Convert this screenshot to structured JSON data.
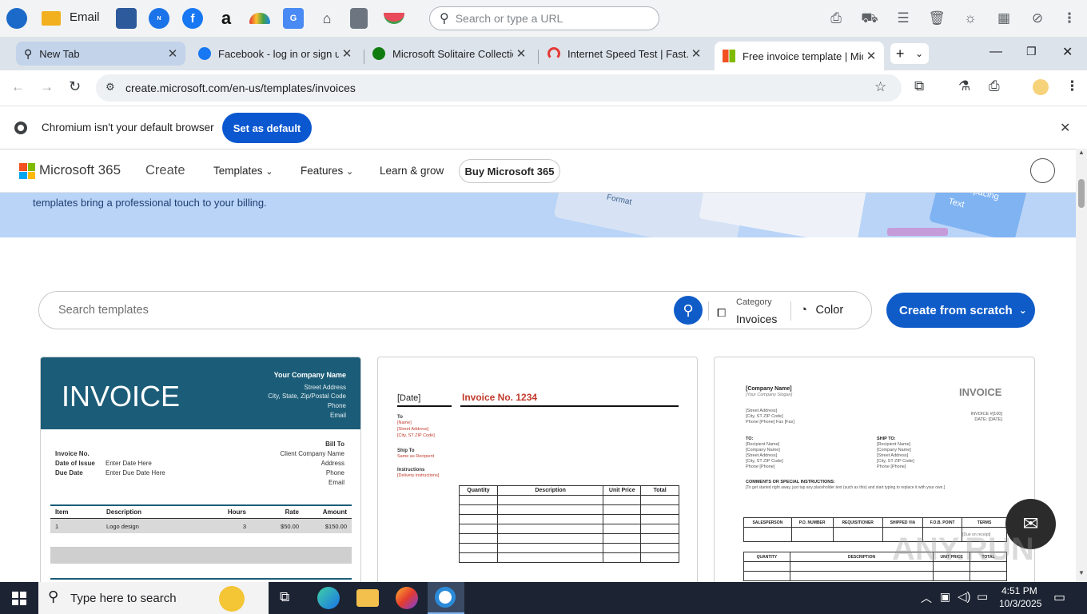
{
  "launcher": {
    "email_label": "Email",
    "omnibox_placeholder": "Search or type a URL"
  },
  "tabs": [
    {
      "title": "New Tab"
    },
    {
      "title": "Facebook - log in or sign up"
    },
    {
      "title": "Microsoft Solitaire Collection"
    },
    {
      "title": "Internet Speed Test | Fast.com"
    },
    {
      "title": "Free invoice template | Microsoft Create"
    }
  ],
  "address_bar": {
    "url": "create.microsoft.com/en-us/templates/invoices"
  },
  "infobar": {
    "message": "Chromium isn't your default browser",
    "button": "Set as default"
  },
  "site_nav": {
    "brand": "Microsoft 365",
    "create": "Create",
    "items": [
      "Templates",
      "Features",
      "Learn & grow"
    ],
    "buy": "Buy Microsoft 365"
  },
  "banner": {
    "text": "templates bring a professional touch to your billing.",
    "illustration_words": [
      "Format",
      "Spacing",
      "Text"
    ]
  },
  "search": {
    "placeholder": "Search templates",
    "category_label": "Category",
    "category_value": "Invoices",
    "color_label": "Color",
    "create_button": "Create from scratch"
  },
  "templates": {
    "card1": {
      "title": "INVOICE",
      "company": "Your Company Name",
      "address_lines": [
        "Street Address",
        "City, State, Zip/Postal Code",
        "Phone",
        "Email"
      ],
      "labels": [
        "Invoice No.",
        "Date of Issue",
        "Due Date"
      ],
      "values": [
        "",
        "Enter Date Here",
        "Enter Due Date Here"
      ],
      "bill_to_label": "Bill To",
      "bill_to_lines": [
        "Client Company Name",
        "Address",
        "Phone",
        "Email"
      ],
      "columns": [
        "Item",
        "Description",
        "Hours",
        "Rate",
        "Amount"
      ],
      "row": [
        "1",
        "Logo design",
        "3",
        "$50.00",
        "$150.00"
      ]
    },
    "card2": {
      "date": "[Date]",
      "title": "Invoice No. 1234",
      "to_label": "To",
      "to_lines": [
        "[Name]",
        "[Street Address]",
        "[City, ST ZIP Code]"
      ],
      "ship_label": "Ship To",
      "ship_line": "Same as Recipient",
      "instr_label": "Instructions",
      "instr_line": "[Delivery instructions]",
      "columns": [
        "Quantity",
        "Description",
        "Unit Price",
        "Total"
      ]
    },
    "card3": {
      "company": "[Company Name]",
      "slogan": "[Your Company Slogan]",
      "title": "INVOICE",
      "address_lines": [
        "[Street Address]",
        "[City, ST ZIP Code]",
        "Phone [Phone]   Fax [Fax]"
      ],
      "invoice_lines": [
        "INVOICE #[100]",
        "DATE: [DATE]"
      ],
      "to_label": "TO:",
      "to_lines": [
        "[Recipient Name]",
        "[Company Name]",
        "[Street Address]",
        "[City, ST ZIP Code]",
        "Phone [Phone]"
      ],
      "ship_label": "SHIP TO:",
      "ship_lines": [
        "[Recipient Name]",
        "[Company Name]",
        "[Street Address]",
        "[City, ST ZIP Code]",
        "Phone [Phone]"
      ],
      "comments_label": "COMMENTS OR SPECIAL INSTRUCTIONS:",
      "comments_text": "[To get started right away, just tap any placeholder text (such as this) and start typing to replace it with your own.]",
      "table1": [
        "SALESPERSON",
        "P.O. NUMBER",
        "REQUISITIONER",
        "SHIPPED VIA",
        "F.O.B. POINT",
        "TERMS"
      ],
      "terms_value": "[Due on receipt]",
      "table2": [
        "QUANTITY",
        "DESCRIPTION",
        "UNIT PRICE",
        "TOTAL"
      ]
    }
  },
  "taskbar": {
    "search_placeholder": "Type here to search",
    "time": "4:51 PM",
    "date": "10/3/2025"
  },
  "watermark": "ANY.RUN",
  "colors": {
    "accent": "#0b57d0",
    "create_button": "#0f5cc9",
    "invoice_header": "#1b5d78",
    "invoice_red": "#c0392b",
    "banner": "#b9d4f7"
  }
}
